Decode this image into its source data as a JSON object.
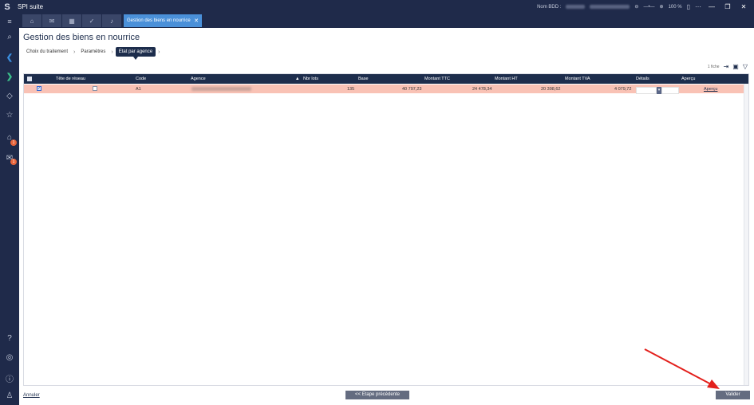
{
  "app": {
    "title": "SPI suite",
    "logo_glyph": "S"
  },
  "titlebar": {
    "nom_bdd_label": "Nom BDD :",
    "zoom": "100 %",
    "minimize": "—",
    "restore": "❐",
    "close": "✕"
  },
  "tabs": {
    "active_label": "Gestion des biens en nourrice",
    "close_glyph": "✕",
    "icons": [
      "home-icon",
      "mail-icon",
      "calendar-icon",
      "check-icon",
      "bell-icon"
    ]
  },
  "page": {
    "title": "Gestion des biens en nourrice"
  },
  "breadcrumb": {
    "items": [
      "Choix du traitement",
      "Paramètres",
      "Etat par agence"
    ],
    "sep": "›"
  },
  "tools": {
    "count": "1 fiche"
  },
  "grid": {
    "columns": [
      "Tête de réseau",
      "Code",
      "Agence",
      "Nbr lots",
      "Base",
      "Montant TTC",
      "Montant HT",
      "Montant TVA",
      "Détails",
      "Aperçu"
    ],
    "row": {
      "code": "A1",
      "base": "135",
      "montant_ttc": "40 797,23",
      "montant_ht": "24 478,34",
      "montant_tva": "20 398,62",
      "montant_tva2": "4 079,72",
      "apercu": "Aperçu"
    }
  },
  "footer": {
    "cancel": "Annuler",
    "previous": "<< Etape précédente",
    "validate": "Valider"
  },
  "colors": {
    "sidebar": "#1f2a4a",
    "accent": "#4a90d9",
    "row_highlight": "#f9c2b5",
    "arrow": "#e3201c"
  }
}
